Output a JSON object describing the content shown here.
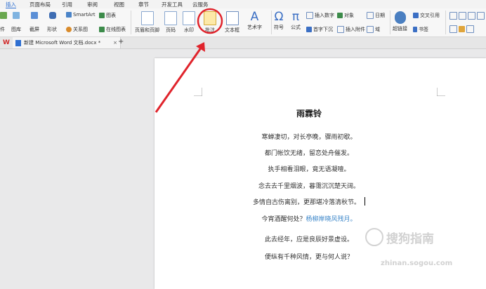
{
  "ribbon": {
    "tabs": [
      "插入",
      "页面布局",
      "引用",
      "审阅",
      "视图",
      "章节",
      "开发工具",
      "云服务"
    ],
    "active_tab": "插入",
    "row1": {
      "smartart": "SmartArt",
      "chart": "图表"
    },
    "row2": {
      "picture": "图库",
      "screenshot": "截屏",
      "shape": "形状",
      "relation": "关系图",
      "online_chart": "在线图表"
    },
    "big_buttons": {
      "header_footer": "页眉和页脚",
      "page_number": "页码",
      "watermark": "水印",
      "comment": "批注",
      "textbox": "文本框",
      "art_text": "艺术字",
      "symbol": "符号",
      "formula": "公式",
      "hyperlink": "超链接"
    },
    "small_buttons": {
      "insert_number": "插入数字",
      "object": "对象",
      "date": "日期",
      "drop_cap": "首字下沉",
      "attachment": "插入附件",
      "field": "域",
      "cross_ref": "交叉引用",
      "bookmark": "书签"
    },
    "left_stub": "件"
  },
  "doc_tabs": {
    "file_name": "新建 Microsoft Word 文档.docx *",
    "close": "×",
    "add": "+"
  },
  "poem": {
    "title": "雨霖铃",
    "lines": [
      "寒蝉凄切，对长亭晚，骤雨初歇。",
      "都门帐饮无绪，留恋处舟催发。",
      "执手相看泪眼，竟无语凝噎。",
      "念去去千里烟波，暮霭沉沉楚天阔。",
      "多情自古伤离别，更那堪冷落清秋节。",
      "今宵酒醒何处？",
      "杨柳岸晓风残月。",
      "此去经年，应是良辰好景虚设。",
      "便纵有千种风情，更与何人说？"
    ]
  },
  "watermark": {
    "brand": "搜狗指南",
    "url": "zhinan.sogou.com"
  },
  "colors": {
    "accent": "#2e6fd1",
    "arrow": "#e0242c",
    "link": "#3b86c9"
  }
}
